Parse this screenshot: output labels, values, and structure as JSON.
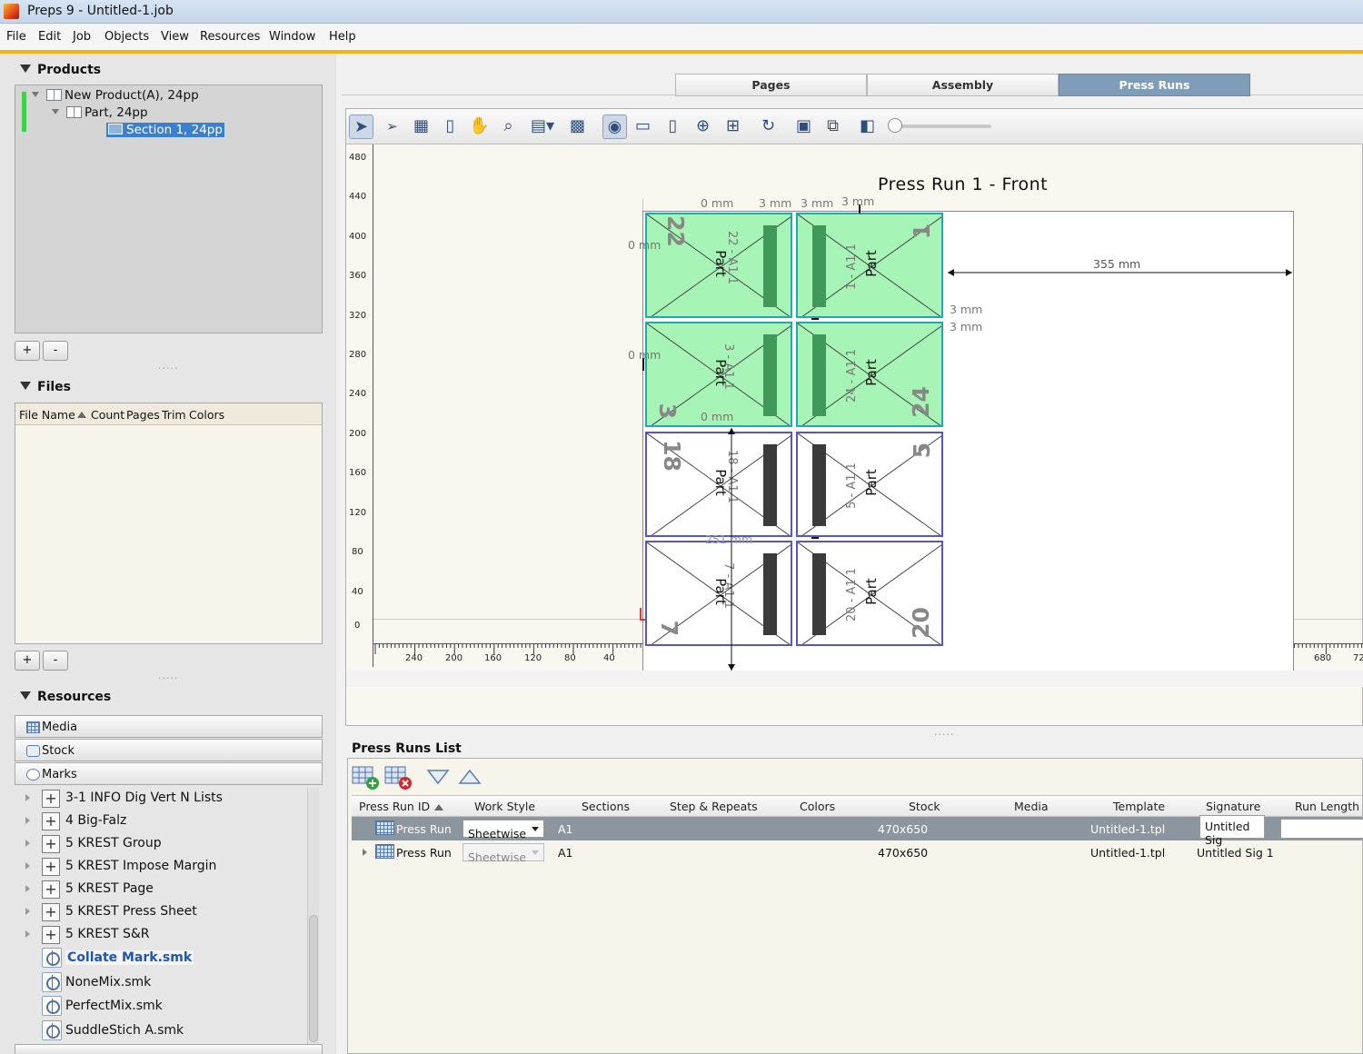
{
  "window": {
    "title": "Preps 9 - Untitled-1.job"
  },
  "menu": [
    "File",
    "Edit",
    "Job",
    "Objects",
    "View",
    "Resources",
    "Window",
    "Help"
  ],
  "products": {
    "header": "Products",
    "tree": [
      {
        "label": "New Product(A), 24pp"
      },
      {
        "label": "Part, 24pp"
      },
      {
        "label": "Section 1, 24pp"
      }
    ],
    "add": "+",
    "remove": "-"
  },
  "files": {
    "header": "Files",
    "columns": [
      "File Name",
      "Count",
      "Pages",
      "Trim",
      "Colors"
    ],
    "add": "+",
    "remove": "-"
  },
  "resources": {
    "header": "Resources",
    "tabs": [
      "Media",
      "Stock",
      "Marks"
    ],
    "marks": [
      "3-1 INFO Dig Vert N Lists",
      "4 Big-Falz",
      "5 KREST Group",
      "5 KREST Impose Margin",
      "5 KREST Page",
      "5 KREST Press Sheet",
      "5 KREST S&R",
      "Collate Mark.smk",
      "NoneMix.smk",
      "PerfectMix.smk",
      "SuddleStich A.smk"
    ]
  },
  "tabs": [
    "Pages",
    "Assembly",
    "Press Runs"
  ],
  "canvas": {
    "title": "Press Run 1  -  Front",
    "v_ruler": [
      "480",
      "440",
      "400",
      "360",
      "320",
      "280",
      "240",
      "200",
      "160",
      "120",
      "80",
      "40",
      "0"
    ],
    "h_ruler": [
      "240",
      "200",
      "160",
      "120",
      "80",
      "40",
      "0",
      "40",
      "80",
      "120",
      "160",
      "200",
      "240",
      "280",
      "320",
      "360",
      "400",
      "440",
      "480",
      "520",
      "560",
      "600",
      "640",
      "680",
      "72"
    ],
    "dims": {
      "top_left": "0 mm",
      "top_gutter_a": "3 mm",
      "top_gutter_b": "3 mm",
      "top_right": "3 mm",
      "left": "0 mm",
      "left_mid": "0 mm",
      "bottom_inner": "0 mm",
      "right_a": "3 mm",
      "right_b": "3 mm",
      "width": "355 mm",
      "height": "251 mm"
    },
    "pages": [
      {
        "num": "22",
        "folio": "22 - A1 1",
        "label": "Part"
      },
      {
        "num": "1",
        "folio": "1 - A1 1",
        "label": "Part"
      },
      {
        "num": "3",
        "folio": "3 - A1 1",
        "label": "Part"
      },
      {
        "num": "24",
        "folio": "24 - A1 1",
        "label": "Part"
      },
      {
        "num": "18",
        "folio": "18 - A1 1",
        "label": "Part"
      },
      {
        "num": "5",
        "folio": "5 - A1 1",
        "label": "Part"
      },
      {
        "num": "7",
        "folio": "7 - A1 1",
        "label": "Part"
      },
      {
        "num": "20",
        "folio": "20 - A1 1",
        "label": "Part"
      }
    ]
  },
  "press_runs": {
    "title": "Press Runs List",
    "columns": [
      "Press Run ID",
      "Work Style",
      "Sections",
      "Step & Repeats",
      "Colors",
      "Stock",
      "Media",
      "Template",
      "Signature",
      "Run Length"
    ],
    "rows": [
      {
        "id": "Press Run",
        "work_style": "Sheetwise",
        "sections": "A1",
        "stock": "470x650",
        "template": "Untitled-1.tpl",
        "signature": "Untitled Sig"
      },
      {
        "id": "Press Run",
        "work_style": "Sheetwise",
        "sections": "A1",
        "stock": "470x650",
        "template": "Untitled-1.tpl",
        "signature": "Untitled Sig 1"
      }
    ]
  }
}
